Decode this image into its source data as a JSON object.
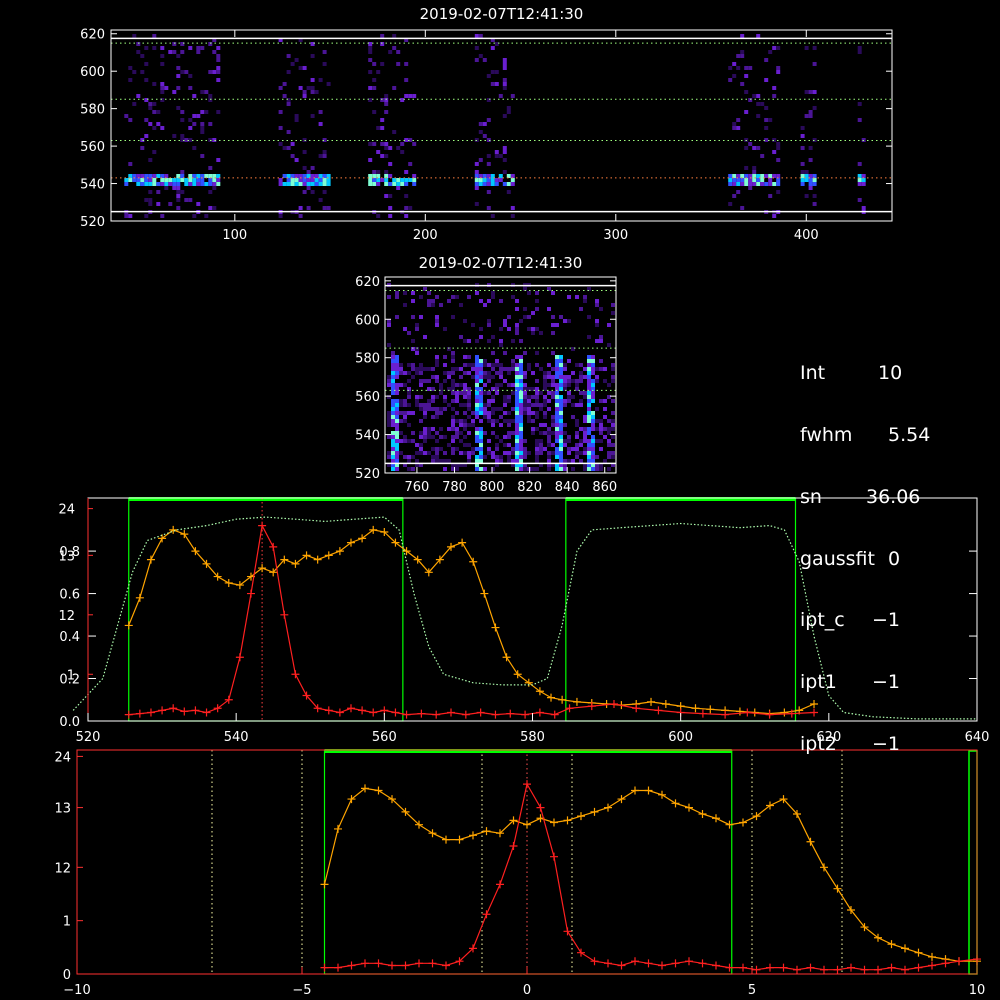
{
  "colors": {
    "background": "#000000",
    "frame": "#ffffff",
    "profile_orange": "#ffa500",
    "gaussian_red": "#ff2020",
    "transmission_green": "#00ff00",
    "dotted_guides": "#ffffaa",
    "red_axis": "#ff3030"
  },
  "info_panel": [
    {
      "key": "Int",
      "value": "10"
    },
    {
      "key": "fwhm",
      "value": "5.54"
    },
    {
      "key": "sn",
      "value": "36.06"
    },
    {
      "key": "gaussfit",
      "value": "0"
    },
    {
      "key": "ipt_c",
      "value": "−1"
    },
    {
      "key": "ipt1",
      "value": "−1"
    },
    {
      "key": "ipt2",
      "value": "−1"
    }
  ],
  "chart_data": [
    {
      "type": "heatmap",
      "title": "2019-02-07T12:41:30",
      "xlim": [
        35,
        445
      ],
      "ylim": [
        520,
        622
      ],
      "x_ticks": [
        100,
        200,
        300,
        400
      ],
      "y_ticks": [
        520,
        540,
        560,
        580,
        600,
        620
      ],
      "dotted_rows": [
        543,
        563,
        585,
        615
      ],
      "bright_row": 543,
      "x_bands": [
        [
          42,
          92
        ],
        [
          123,
          149
        ],
        [
          170,
          195
        ],
        [
          226,
          246
        ],
        [
          359,
          386
        ],
        [
          397,
          405
        ],
        [
          427,
          431
        ]
      ],
      "colormap": "dark purple to cyan/green"
    },
    {
      "type": "heatmap",
      "title": "2019-02-07T12:41:30",
      "xlim": [
        743,
        866
      ],
      "ylim": [
        520,
        622
      ],
      "x_ticks": [
        760,
        780,
        800,
        820,
        840,
        860
      ],
      "y_ticks": [
        520,
        540,
        560,
        580,
        600,
        620
      ],
      "dotted_rows": [
        563,
        585,
        615
      ],
      "bright_columns": [
        748,
        792,
        813,
        835,
        852
      ]
    },
    {
      "type": "line",
      "xlim": [
        520,
        640
      ],
      "x_ticks": [
        520,
        540,
        560,
        580,
        600,
        620,
        640
      ],
      "left_ticks": [
        "0.0",
        "0.2",
        "0.4",
        "0.6",
        "0.8"
      ],
      "left_ylim": [
        0,
        1.05
      ],
      "red_left_ticks": [
        "1",
        "12",
        "13",
        "24"
      ],
      "green_bands": [
        [
          525.5,
          562.5
        ],
        [
          584.5,
          615.5
        ]
      ],
      "vertical_marker": 543.5,
      "series": [
        {
          "color": "orange",
          "x": [
            525.5,
            527,
            528.5,
            530,
            531.5,
            533,
            534.5,
            536,
            537.5,
            539,
            540.5,
            542,
            543.5,
            545,
            546.5,
            548,
            549.5,
            551,
            552.5,
            554,
            555.5,
            557,
            558.5,
            560,
            561.5,
            563,
            564.5,
            566,
            567.5,
            569,
            570.5,
            572,
            573.5,
            575,
            576.5,
            578,
            579.5,
            581,
            582.5,
            584,
            586,
            588,
            590,
            592,
            594,
            596,
            598,
            600,
            602,
            604,
            606,
            608,
            610,
            612,
            614,
            616,
            618
          ],
          "y": [
            0.45,
            0.58,
            0.76,
            0.86,
            0.9,
            0.88,
            0.8,
            0.74,
            0.68,
            0.65,
            0.64,
            0.68,
            0.72,
            0.7,
            0.76,
            0.74,
            0.78,
            0.76,
            0.78,
            0.8,
            0.84,
            0.86,
            0.9,
            0.89,
            0.84,
            0.8,
            0.76,
            0.7,
            0.76,
            0.82,
            0.84,
            0.75,
            0.6,
            0.44,
            0.3,
            0.22,
            0.18,
            0.14,
            0.11,
            0.1,
            0.09,
            0.085,
            0.08,
            0.075,
            0.08,
            0.09,
            0.08,
            0.07,
            0.06,
            0.055,
            0.05,
            0.045,
            0.04,
            0.035,
            0.04,
            0.05,
            0.08
          ]
        },
        {
          "color": "red",
          "x": [
            525.5,
            527,
            528.5,
            530,
            531.5,
            533,
            534.5,
            536,
            537.5,
            539,
            540.5,
            542,
            543.5,
            545,
            546.5,
            548,
            549.5,
            551,
            552.5,
            554,
            555.5,
            557,
            558.5,
            560,
            561.5,
            563,
            565,
            567,
            569,
            571,
            573,
            575,
            577,
            579,
            581,
            583,
            585,
            588,
            591,
            594,
            597,
            600,
            603,
            606,
            609,
            612,
            615,
            618
          ],
          "y": [
            0.03,
            0.035,
            0.04,
            0.05,
            0.06,
            0.045,
            0.05,
            0.04,
            0.06,
            0.1,
            0.3,
            0.6,
            0.92,
            0.82,
            0.5,
            0.22,
            0.12,
            0.06,
            0.05,
            0.04,
            0.06,
            0.05,
            0.04,
            0.05,
            0.04,
            0.03,
            0.035,
            0.03,
            0.04,
            0.03,
            0.04,
            0.03,
            0.035,
            0.03,
            0.04,
            0.03,
            0.06,
            0.07,
            0.08,
            0.06,
            0.05,
            0.04,
            0.035,
            0.03,
            0.04,
            0.03,
            0.035,
            0.04
          ]
        },
        {
          "color": "green-dotted",
          "x": [
            518,
            522,
            524,
            526,
            528,
            532,
            536,
            540,
            544,
            548,
            552,
            556,
            560,
            562,
            564,
            566,
            568,
            572,
            576,
            580,
            582,
            584,
            586,
            588,
            592,
            596,
            600,
            604,
            608,
            612,
            614,
            616,
            618,
            620,
            622,
            626,
            632,
            640
          ],
          "y": [
            0.05,
            0.2,
            0.45,
            0.7,
            0.85,
            0.9,
            0.92,
            0.95,
            0.96,
            0.95,
            0.94,
            0.95,
            0.96,
            0.9,
            0.6,
            0.35,
            0.22,
            0.18,
            0.17,
            0.17,
            0.2,
            0.45,
            0.8,
            0.9,
            0.91,
            0.92,
            0.93,
            0.92,
            0.91,
            0.92,
            0.9,
            0.75,
            0.4,
            0.12,
            0.04,
            0.02,
            0.01,
            0.01
          ]
        }
      ]
    },
    {
      "type": "line",
      "xlim": [
        -10,
        10
      ],
      "x_ticks": [
        -10,
        -5,
        0,
        5,
        10
      ],
      "left_ticks": [
        "0",
        "1",
        "12",
        "13",
        "24"
      ],
      "left_ylim": [
        0,
        1.05
      ],
      "green_band": [
        -4.5,
        4.55
      ],
      "dotted_verticals": [
        -7,
        -5,
        -1,
        0,
        1,
        5,
        7
      ],
      "series": [
        {
          "color": "orange",
          "x": [
            -4.5,
            -4.2,
            -3.9,
            -3.6,
            -3.3,
            -3.0,
            -2.7,
            -2.4,
            -2.1,
            -1.8,
            -1.5,
            -1.2,
            -0.9,
            -0.6,
            -0.3,
            0,
            0.3,
            0.6,
            0.9,
            1.2,
            1.5,
            1.8,
            2.1,
            2.4,
            2.7,
            3.0,
            3.3,
            3.6,
            3.9,
            4.2,
            4.5,
            4.8,
            5.1,
            5.4,
            5.7,
            6.0,
            6.3,
            6.6,
            6.9,
            7.2,
            7.5,
            7.8,
            8.1,
            8.4,
            8.7,
            9.0,
            9.3,
            9.6,
            10
          ],
          "y": [
            0.42,
            0.68,
            0.82,
            0.87,
            0.86,
            0.82,
            0.76,
            0.7,
            0.66,
            0.63,
            0.63,
            0.65,
            0.67,
            0.66,
            0.72,
            0.7,
            0.73,
            0.71,
            0.72,
            0.74,
            0.76,
            0.78,
            0.82,
            0.86,
            0.86,
            0.84,
            0.8,
            0.78,
            0.75,
            0.73,
            0.7,
            0.71,
            0.74,
            0.79,
            0.82,
            0.75,
            0.62,
            0.5,
            0.4,
            0.3,
            0.22,
            0.17,
            0.14,
            0.12,
            0.1,
            0.08,
            0.07,
            0.06,
            0.06
          ]
        },
        {
          "color": "red",
          "x": [
            -4.5,
            -4.2,
            -3.9,
            -3.6,
            -3.3,
            -3.0,
            -2.7,
            -2.4,
            -2.1,
            -1.8,
            -1.5,
            -1.2,
            -0.9,
            -0.6,
            -0.3,
            0,
            0.3,
            0.6,
            0.9,
            1.2,
            1.5,
            1.8,
            2.1,
            2.4,
            2.7,
            3.0,
            3.3,
            3.6,
            3.9,
            4.2,
            4.5,
            4.8,
            5.1,
            5.4,
            5.7,
            6.0,
            6.3,
            6.6,
            6.9,
            7.2,
            7.5,
            7.8,
            8.1,
            8.4,
            8.7,
            9.0,
            9.3,
            9.6,
            10
          ],
          "y": [
            0.03,
            0.03,
            0.04,
            0.05,
            0.05,
            0.04,
            0.04,
            0.05,
            0.05,
            0.04,
            0.06,
            0.12,
            0.28,
            0.42,
            0.6,
            0.89,
            0.78,
            0.55,
            0.2,
            0.1,
            0.06,
            0.05,
            0.04,
            0.06,
            0.05,
            0.04,
            0.05,
            0.06,
            0.05,
            0.04,
            0.03,
            0.03,
            0.02,
            0.03,
            0.03,
            0.02,
            0.03,
            0.02,
            0.02,
            0.03,
            0.02,
            0.02,
            0.03,
            0.02,
            0.03,
            0.04,
            0.05,
            0.06,
            0.07
          ]
        }
      ]
    }
  ]
}
